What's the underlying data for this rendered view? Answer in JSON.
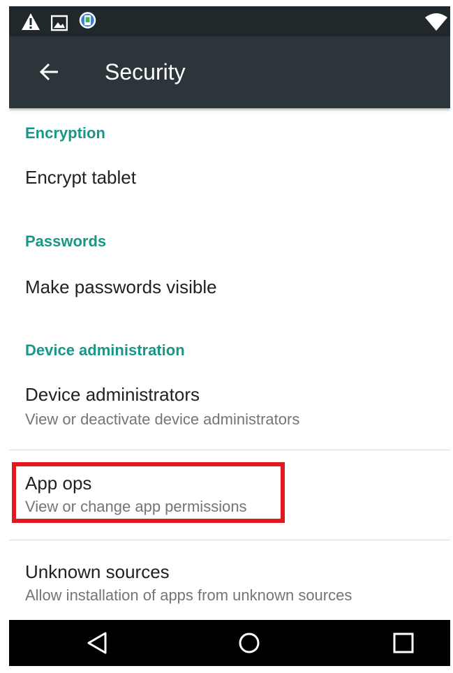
{
  "status_bar": {
    "icons": [
      "warning-icon",
      "image-icon",
      "app-notification-icon",
      "wifi-icon"
    ]
  },
  "toolbar": {
    "back_icon": "arrow-back-icon",
    "title": "Security"
  },
  "sections": [
    {
      "header": "Encryption",
      "items": [
        {
          "title": "Encrypt tablet"
        }
      ]
    },
    {
      "header": "Passwords",
      "items": [
        {
          "title": "Make passwords visible"
        }
      ]
    },
    {
      "header": "Device administration",
      "items": [
        {
          "title": "Device administrators",
          "subtitle": "View or deactivate device administrators"
        },
        {
          "title": "App ops",
          "subtitle": "View or change app permissions",
          "highlighted": true
        },
        {
          "title": "Unknown sources",
          "subtitle": "Allow installation of apps from unknown sources"
        }
      ]
    }
  ],
  "nav_bar": {
    "icons": [
      "nav-back-icon",
      "nav-home-icon",
      "nav-recents-icon"
    ]
  },
  "colors": {
    "status_bar": "#21282c",
    "toolbar": "#2c363a",
    "accent": "#199688",
    "highlight_box": "#e0191f",
    "nav_bar": "#000000"
  }
}
